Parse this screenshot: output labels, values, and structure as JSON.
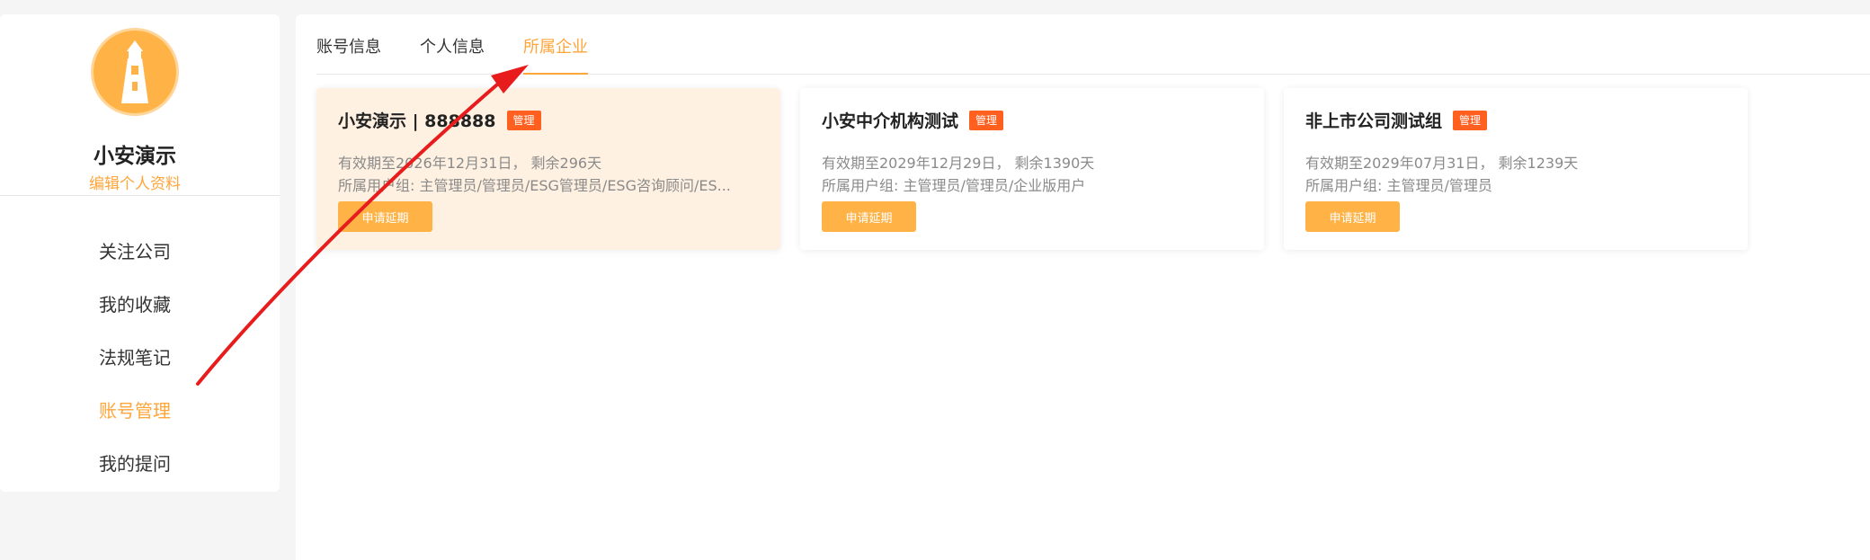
{
  "profile": {
    "name": "小安演示",
    "edit_label": "编辑个人资料"
  },
  "sidebar": {
    "items": [
      {
        "label": "关注公司"
      },
      {
        "label": "我的收藏"
      },
      {
        "label": "法规笔记"
      },
      {
        "label": "账号管理",
        "active": true
      },
      {
        "label": "我的提问"
      }
    ]
  },
  "tabs": [
    {
      "label": "账号信息"
    },
    {
      "label": "个人信息"
    },
    {
      "label": "所属企业",
      "active": true
    }
  ],
  "cards": [
    {
      "title": "小安演示 | 888888",
      "badge": "管理",
      "validity": "有效期至2026年12月31日， 剩余296天",
      "groups": "所属用户组: 主管理员/管理员/ESG管理员/ESG咨询顾问/ES...",
      "button": "申请延期"
    },
    {
      "title": "小安中介机构测试",
      "badge": "管理",
      "validity": "有效期至2029年12月29日， 剩余1390天",
      "groups": "所属用户组: 主管理员/管理员/企业版用户",
      "button": "申请延期"
    },
    {
      "title": "非上市公司测试组",
      "badge": "管理",
      "validity": "有效期至2029年07月31日， 剩余1239天",
      "groups": "所属用户组: 主管理员/管理员",
      "button": "申请延期"
    }
  ],
  "colors": {
    "accent": "#ffa53a",
    "badge": "#ff5f1f",
    "annotation_arrow": "#e81c1c"
  }
}
